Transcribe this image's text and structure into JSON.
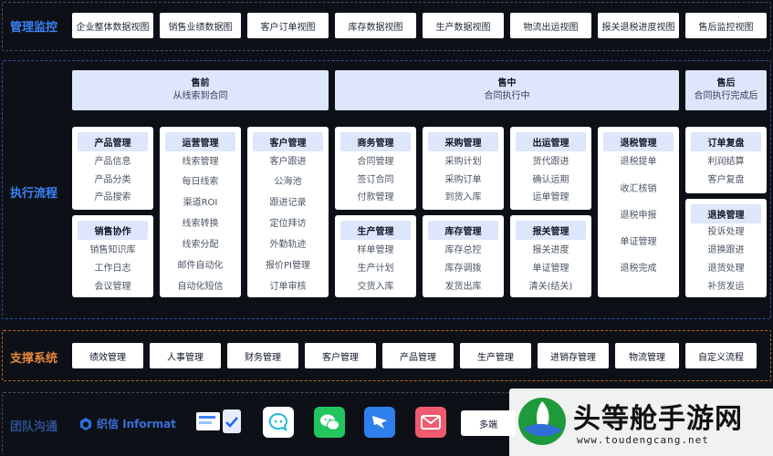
{
  "colors": {
    "bg": "#0d1117",
    "mgmt_border": "#4a4d55",
    "exec_border": "#2d4aa8",
    "support_border": "#b4622a",
    "accent_blue": "#3b82f6",
    "accent_orange": "#e5863a"
  },
  "monitor": {
    "label": "管理监控",
    "buttons": [
      "企业整体数据视图",
      "销售业绩数据图",
      "客户订单视图",
      "库存数据视图",
      "生产数据视图",
      "物流出运视图",
      "报关退税进度视图",
      "售后监控视图"
    ]
  },
  "execution": {
    "label": "执行流程",
    "phases": [
      {
        "title": "售前",
        "subtitle": "从线索到合同"
      },
      {
        "title": "售中",
        "subtitle": "合同执行中"
      },
      {
        "title": "售后",
        "subtitle": "合同执行完成后"
      }
    ],
    "cards": {
      "product": {
        "title": "产品管理",
        "items": [
          "产品信息",
          "产品分类",
          "产品搜索"
        ]
      },
      "sales": {
        "title": "销售协作",
        "items": [
          "销售知识库",
          "工作日志",
          "会议管理"
        ]
      },
      "ops": {
        "title": "运营管理",
        "items": [
          "线索管理",
          "每日线索",
          "渠道ROI",
          "线索转换",
          "线索分配",
          "邮件自动化",
          "自动化短信"
        ]
      },
      "customer": {
        "title": "客户管理",
        "items": [
          "客户跟进",
          "公海池",
          "跟进记录",
          "定位拜访",
          "外勤轨迹",
          "报价PI管理",
          "订单审核"
        ]
      },
      "business": {
        "title": "商务管理",
        "items": [
          "合同管理",
          "签订合同",
          "付款管理"
        ]
      },
      "production": {
        "title": "生产管理",
        "items": [
          "样单管理",
          "生产计划",
          "交货入库"
        ]
      },
      "purchase": {
        "title": "采购管理",
        "items": [
          "采购计划",
          "采购订单",
          "到货入库"
        ]
      },
      "inventory": {
        "title": "库存管理",
        "items": [
          "库存总控",
          "库存调拨",
          "发货出库"
        ]
      },
      "shipping": {
        "title": "出运管理",
        "items": [
          "货代跟进",
          "确认运期",
          "运单管理"
        ]
      },
      "customs": {
        "title": "报关管理",
        "items": [
          "报关进度",
          "单证管理",
          "清关(结关)"
        ]
      },
      "tax": {
        "title": "退税管理",
        "items": [
          "退税提单",
          "收汇核销",
          "退税申报",
          "单证管理",
          "退税完成"
        ]
      },
      "review": {
        "title": "订单复盘",
        "items": [
          "利润结算",
          "客户复盘"
        ]
      },
      "returns": {
        "title": "退换管理",
        "items": [
          "投诉处理",
          "退换跟进",
          "退货处理",
          "补货发运"
        ]
      }
    }
  },
  "support": {
    "label": "支撑系统",
    "buttons": [
      "绩效管理",
      "人事管理",
      "财务管理",
      "客户管理",
      "产品管理",
      "生产管理",
      "进销存管理",
      "物流管理",
      "自定义流程"
    ]
  },
  "team": {
    "label": "团队沟通",
    "logo_text": "织信 Informat",
    "icons": [
      "sync-icon",
      "chat-bubble-icon",
      "wechat-icon",
      "dingtalk-icon",
      "mail-icon"
    ],
    "multi_label": "多端"
  },
  "watermark": {
    "brand": "头等舱手游网",
    "url": "www.toudengcang.net"
  }
}
